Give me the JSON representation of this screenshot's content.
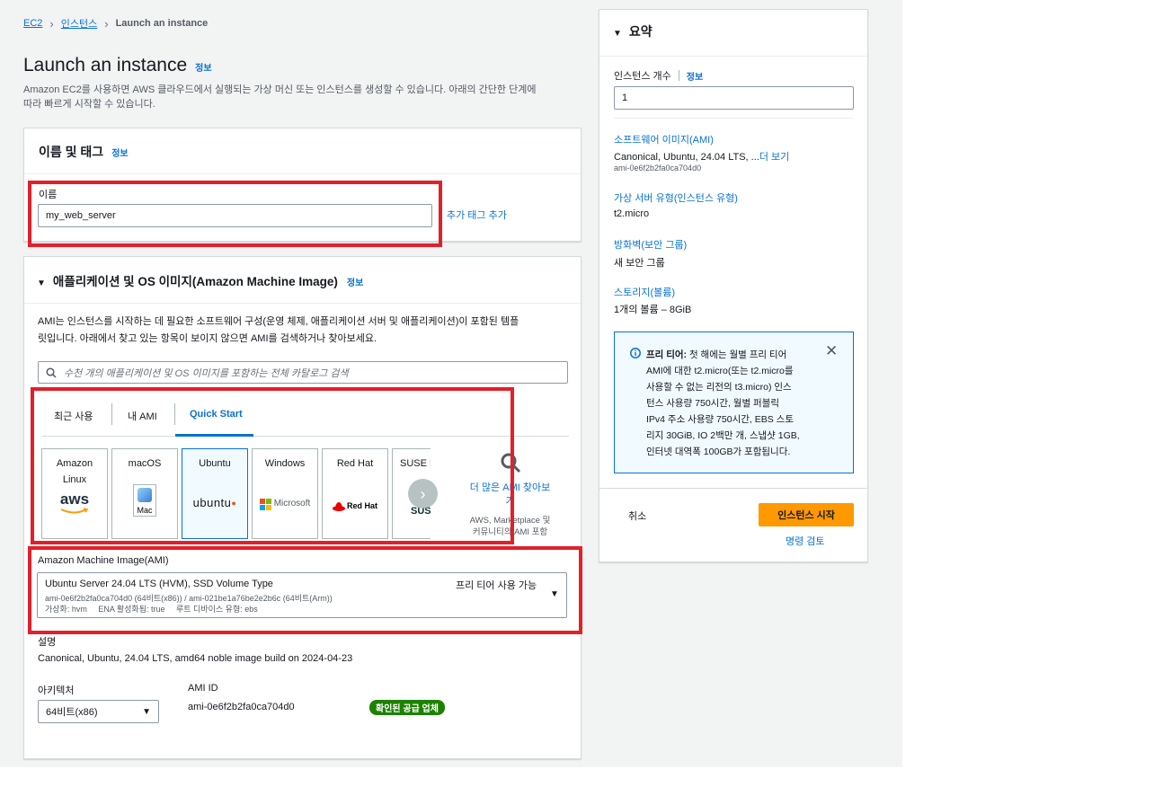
{
  "breadcrumb": {
    "ec2": "EC2",
    "instances": "인스턴스",
    "current": "Launch an instance"
  },
  "header": {
    "title": "Launch an instance",
    "info": "정보",
    "description_line1": "Amazon EC2를 사용하면 AWS 클라우드에서 실행되는 가상 머신 또는 인스턴스를 생성할 수 있습니다. 아래의 간단한 단계에",
    "description_line2": "따라 빠르게 시작할 수 있습니다."
  },
  "name_tags": {
    "title": "이름 및 태그",
    "info": "정보",
    "name_label": "이름",
    "name_value": "my_web_server",
    "add_tags": "추가 태그 추가"
  },
  "ami_section": {
    "title": "애플리케이션 및 OS 이미지(Amazon Machine Image)",
    "info": "정보",
    "description_line1": "AMI는 인스턴스를 시작하는 데 필요한 소프트웨어 구성(운영 체제, 애플리케이션 서버 및 애플리케이션)이 포함된 템플",
    "description_line2": "릿입니다. 아래에서 찾고 있는 항목이 보이지 않으면 AMI를 검색하거나 찾아보세요.",
    "search_placeholder": "수천 개의 애플리케이션 및 OS 이미지를 포함하는 전체 카탈로그 검색",
    "tabs": [
      "최근 사용",
      "내 AMI",
      "Quick Start"
    ],
    "os_tiles": {
      "amazon_line1": "Amazon",
      "amazon_line2": "Linux",
      "amazon_logo": "aws",
      "macos": "macOS",
      "macos_logo": "Mac",
      "ubuntu": "Ubuntu",
      "ubuntu_logo": "ubuntu",
      "windows": "Windows",
      "windows_logo": "Microsoft",
      "redhat": "Red Hat",
      "redhat_logo": "Red Hat",
      "suse": "SUSE L",
      "suse_logo": "SUS"
    },
    "browse_more_line1": "더 많은 AMI 찾아보",
    "browse_more_line2": "기",
    "browse_more_sub_line1": "AWS, Marketplace 및",
    "browse_more_sub_line2": "커뮤니티의 AMI 포함",
    "ami_label": "Amazon Machine Image(AMI)",
    "ami_name": "Ubuntu Server 24.04 LTS (HVM), SSD Volume Type",
    "ami_ids": "ami-0e6f2b2fa0ca704d0 (64비트(x86)) / ami-021be1a76be2e2b6c (64비트(Arm))",
    "ami_meta": "가상화: hvm     ENA 활성화됨: true     루트 디바이스 유형: ebs",
    "free_tier_badge": "프리 티어 사용 가능",
    "desc_label": "설명",
    "desc_value": "Canonical, Ubuntu, 24.04 LTS, amd64 noble image build on 2024-04-23",
    "arch_label": "아키텍처",
    "arch_value": "64비트(x86)",
    "ami_id_label": "AMI ID",
    "ami_id_value": "ami-0e6f2b2fa0ca704d0",
    "verified_badge": "확인된 공급 업체"
  },
  "summary": {
    "title": "요약",
    "count_label": "인스턴스 개수",
    "info": "정보",
    "count_value": "1",
    "software_label": "소프트웨어 이미지(AMI)",
    "software_value": "Canonical, Ubuntu, 24.04 LTS, ...",
    "more_link": "더 보기",
    "software_id": "ami-0e6f2b2fa0ca704d0",
    "type_label": "가상 서버 유형(인스턴스 유형)",
    "type_value": "t2.micro",
    "firewall_label": "방화벽(보안 그룹)",
    "firewall_value": "새 보안 그룹",
    "storage_label": "스토리지(볼륨)",
    "storage_value": "1개의 볼륨 – 8GiB",
    "free_tier_lines": [
      "프리 티어: 첫 해에는 월별 프리 티어",
      "AMI에 대한 t2.micro(또는 t2.micro를",
      "사용할 수 없는 리전의 t3.micro) 인스",
      "턴스 사용량 750시간, 월별 퍼블릭",
      "IPv4 주소 사용량 750시간, EBS 스토",
      "리지 30GiB, IO 2백만 개, 스냅샷 1GB,",
      "인터넷 대역폭 100GB가 포함됩니다."
    ],
    "cancel": "취소",
    "launch": "인스턴스 시작",
    "review": "명령 검토"
  },
  "colors": {
    "accent": "#0972d3",
    "launch_button": "#ff9900",
    "highlight_box": "#e3202a",
    "verified_badge": "#1d8102"
  }
}
